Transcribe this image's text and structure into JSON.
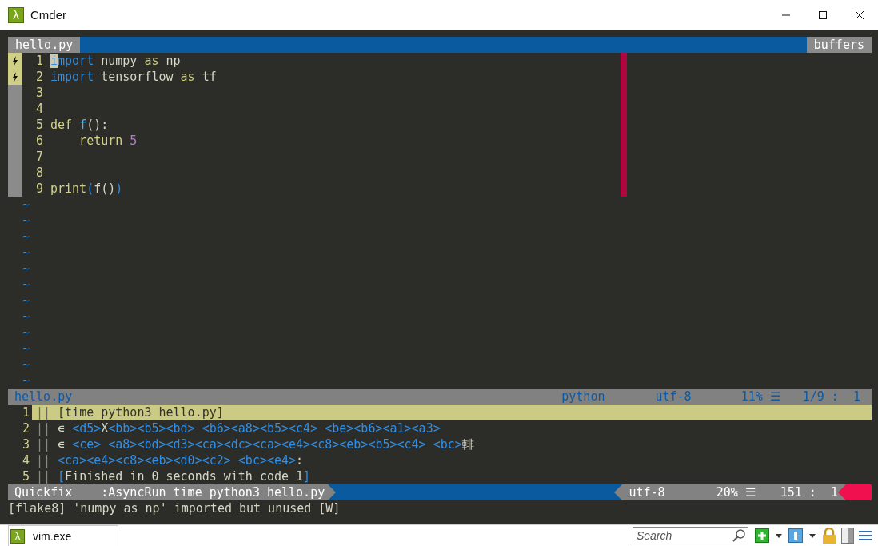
{
  "window": {
    "icon": "λ",
    "title": "Cmder"
  },
  "tabline": {
    "tabs": [
      {
        "label": "hello.py",
        "selected": true
      }
    ],
    "right": "buffers"
  },
  "editor": {
    "lines": [
      {
        "number": "1",
        "flagged": true,
        "cursor": true,
        "tokens": [
          {
            "kind": "keyword",
            "text": "import"
          },
          {
            "kind": "plain",
            "text": " numpy "
          },
          {
            "kind": "operator",
            "text": "as"
          },
          {
            "kind": "plain",
            "text": " np"
          }
        ]
      },
      {
        "number": "2",
        "flagged": true,
        "cursor": false,
        "tokens": [
          {
            "kind": "keyword",
            "text": "import"
          },
          {
            "kind": "plain",
            "text": " tensorflow "
          },
          {
            "kind": "operator",
            "text": "as"
          },
          {
            "kind": "plain",
            "text": " tf"
          }
        ]
      },
      {
        "number": "3",
        "flagged": false,
        "cursor": false
      },
      {
        "number": "4",
        "flagged": false,
        "cursor": false
      },
      {
        "number": "5",
        "flagged": false,
        "cursor": false,
        "tokens": [
          {
            "kind": "statement",
            "text": "def "
          },
          {
            "kind": "function",
            "text": "f"
          },
          {
            "kind": "plain",
            "text": "():"
          }
        ]
      },
      {
        "number": "6",
        "flagged": false,
        "cursor": false,
        "tokens": [
          {
            "kind": "statement",
            "text": "    return"
          },
          {
            "kind": "number",
            "text": " 5"
          }
        ]
      },
      {
        "number": "7",
        "flagged": false,
        "cursor": false
      },
      {
        "number": "8",
        "flagged": false,
        "cursor": false
      },
      {
        "number": "9",
        "flagged": false,
        "cursor": false,
        "tokens": [
          {
            "kind": "statement",
            "text": "print"
          },
          {
            "kind": "bracket",
            "text": "("
          },
          {
            "kind": "plain",
            "text": "f()"
          },
          {
            "kind": "bracket",
            "text": ")"
          }
        ]
      }
    ],
    "empty_lines": [
      "~",
      "~",
      "~",
      "~",
      "~",
      "~",
      "~",
      "~",
      "~",
      "~",
      "~",
      "~"
    ]
  },
  "status_line": {
    "file": "hello.py",
    "filetype": "python",
    "encoding": "utf-8",
    "percent": "11% ☰",
    "position": "1/9 :  1"
  },
  "quickfix": {
    "lines": [
      {
        "number": "1",
        "separator": "||",
        "selected": true,
        "tokens": [
          {
            "kind": "plain",
            "text": "[time python3 hello.py]"
          }
        ]
      },
      {
        "number": "2",
        "separator": "||",
        "selected": false,
        "tokens": [
          {
            "kind": "plain",
            "text": "∊ "
          },
          {
            "kind": "escape",
            "text": "<d5>"
          },
          {
            "kind": "plain",
            "text": "X"
          },
          {
            "kind": "escape",
            "text": "<bb><b5><bd> <b6><a8><b5><c4> <be><b6><a1><a3>"
          }
        ]
      },
      {
        "number": "3",
        "separator": "||",
        "selected": false,
        "tokens": [
          {
            "kind": "plain",
            "text": "∊ "
          },
          {
            "kind": "escape",
            "text": "<ce> <a8><bd><d3><ca><dc><ca><e4><c8><eb><b5><c4> <bc>"
          },
          {
            "kind": "plain",
            "text": "輫"
          }
        ]
      },
      {
        "number": "4",
        "separator": "||",
        "selected": false,
        "tokens": [
          {
            "kind": "escape",
            "text": "<ca><e4><c8><eb><d0><c2> <bc><e4>"
          },
          {
            "kind": "plain",
            "text": ":"
          }
        ]
      },
      {
        "number": "5",
        "separator": "||",
        "selected": false,
        "tokens": [
          {
            "kind": "escape",
            "text": "["
          },
          {
            "kind": "plain",
            "text": "Finished in 0 seconds with code 1"
          },
          {
            "kind": "escape",
            "text": "]"
          }
        ]
      }
    ]
  },
  "quickfix_status": {
    "mode": "Quickfix",
    "command": ":AsyncRun time python3 hello.py",
    "encoding": "utf-8",
    "percent": "20% ☰",
    "position": "151 :  1"
  },
  "message": "[flake8] 'numpy as np' imported but unused [W]",
  "taskbar": {
    "icon": "λ",
    "tab": "vim.exe",
    "search": {
      "placeholder": "Search"
    }
  }
}
